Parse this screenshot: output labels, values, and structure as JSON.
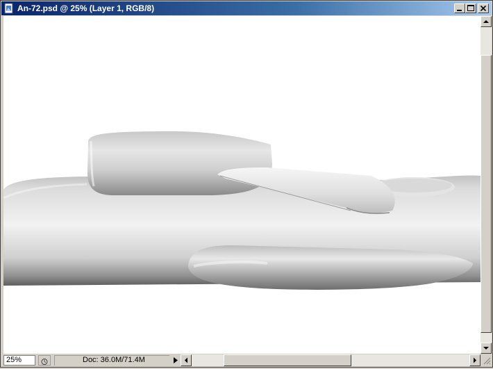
{
  "window": {
    "title": "An-72.psd @ 25% (Layer 1, RGB/8)",
    "icons": {
      "document": "photoshop-document-icon",
      "minimize": "minimize-icon",
      "maximize": "maximize-icon",
      "close": "close-icon"
    }
  },
  "status_bar": {
    "zoom": "25%",
    "doc_info": "Doc: 36.0M/71.4M",
    "icons": {
      "status": "status-menu-icon",
      "arrow": "triangle-right-icon"
    }
  },
  "scrollbars": {
    "icons": {
      "up": "arrow-up-icon",
      "down": "arrow-down-icon",
      "left": "arrow-left-icon",
      "right": "arrow-right-icon"
    }
  },
  "colors": {
    "titlebar_start": "#0a246a",
    "titlebar_end": "#a6caf0",
    "chrome": "#d4d0c8",
    "canvas": "#ffffff"
  }
}
